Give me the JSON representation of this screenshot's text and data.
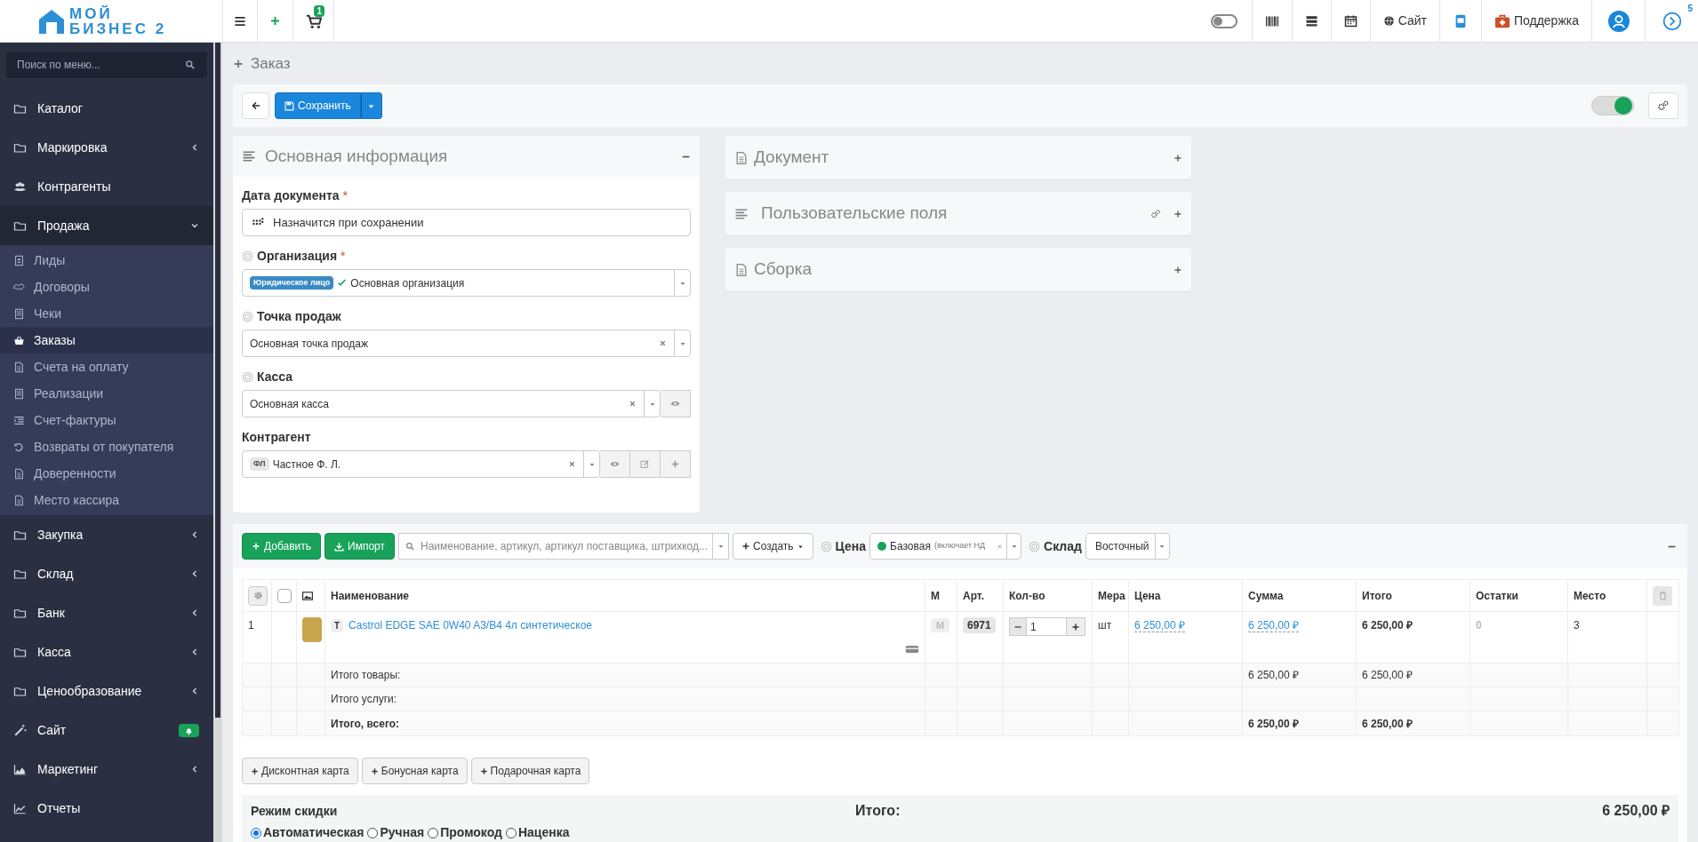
{
  "header": {
    "logo_top": "МОЙ",
    "logo_bottom": "БИЗНЕС 2",
    "cart_badge": "1",
    "mode_toggle_on": false,
    "site_link": "Сайт",
    "support_link": "Поддержка",
    "updates_badge": "5"
  },
  "sidebar": {
    "search_placeholder": "Поиск по меню...",
    "items": [
      {
        "kind": "link",
        "label": "Каталог"
      },
      {
        "kind": "group",
        "label": "Маркировка",
        "expanded": false
      },
      {
        "kind": "link",
        "label": "Контрагенты"
      },
      {
        "kind": "group",
        "label": "Продажа",
        "expanded": true,
        "children": [
          {
            "label": "Лиды",
            "selected": false
          },
          {
            "label": "Договоры",
            "selected": false
          },
          {
            "label": "Чеки",
            "selected": false
          },
          {
            "label": "Заказы",
            "selected": true
          },
          {
            "label": "Счета на оплату",
            "selected": false
          },
          {
            "label": "Реализации",
            "selected": false
          },
          {
            "label": "Счет-фактуры",
            "selected": false
          },
          {
            "label": "Возвраты от покупателя",
            "selected": false
          },
          {
            "label": "Доверенности",
            "selected": false
          },
          {
            "label": "Место кассира",
            "selected": false
          }
        ]
      },
      {
        "kind": "group",
        "label": "Закупка",
        "expanded": false
      },
      {
        "kind": "group",
        "label": "Склад",
        "expanded": false
      },
      {
        "kind": "group",
        "label": "Банк",
        "expanded": false
      },
      {
        "kind": "group",
        "label": "Касса",
        "expanded": false
      },
      {
        "kind": "group",
        "label": "Ценообразование",
        "expanded": false
      },
      {
        "kind": "link",
        "label": "Сайт",
        "bell_badge": true
      },
      {
        "kind": "group",
        "label": "Маркетинг",
        "expanded": false
      },
      {
        "kind": "link",
        "label": "Отчеты"
      }
    ]
  },
  "page_title": "Заказ",
  "toolbar": {
    "save_button": "Сохранить",
    "active_toggle_on": true
  },
  "main_info": {
    "title": "Основная информация",
    "fields": [
      {
        "kind": "date",
        "label": "Дата документа",
        "required_mark": "*",
        "value": "Назначится при сохранении"
      },
      {
        "kind": "select",
        "label": "Организация",
        "required_mark": "*",
        "hint_icon": true,
        "tag": "Юридическое лицо",
        "verified": true,
        "value": "Основная организация",
        "clearable": false
      },
      {
        "kind": "select",
        "label": "Точка продаж",
        "hint_icon": true,
        "value": "Основная точка продаж",
        "clearable": true
      },
      {
        "kind": "select-view",
        "label": "Касса",
        "hint_icon": true,
        "value": "Основная касса",
        "clearable": true
      },
      {
        "kind": "select-actions",
        "label": "Контрагент",
        "hint_icon": false,
        "tag": "ФЛ",
        "value": "Частное Ф. Л.",
        "clearable": true
      }
    ]
  },
  "side_panels": [
    {
      "kind": "document",
      "title": "Документ",
      "settings": false
    },
    {
      "kind": "list",
      "title": "Пользовательские поля",
      "settings": true
    },
    {
      "kind": "document",
      "title": "Сборка",
      "settings": false
    }
  ],
  "items_panel": {
    "add_button": "Добавить",
    "import_button": "Импорт",
    "search_placeholder": "Наименование, артикул, артикул поставщика, штрихкод...",
    "create_button": "Создать",
    "price_label": "Цена",
    "price_value": "Базовая",
    "price_note": "(включает НД",
    "warehouse_label": "Склад",
    "warehouse_value": "Восточный",
    "select_all_checked": false,
    "columns": [
      "Наименование",
      "М",
      "Арт.",
      "Кол-во",
      "Мера",
      "Цена",
      "Сумма",
      "Итого",
      "Остатки",
      "Место"
    ],
    "rows": [
      {
        "number": "1",
        "type_tag": "Т",
        "name": "Castrol EDGE SAE 0W40 A3/B4 4л синтетическое",
        "marking": "М",
        "article": "6971",
        "quantity": "1",
        "unit": "шт",
        "price": "6 250,00 ₽",
        "sum": "6 250,00 ₽",
        "total": "6 250,00 ₽",
        "stock": "0",
        "place": "3"
      }
    ],
    "totals": [
      {
        "kind": "plain",
        "label": "Итого товары:",
        "sum": "6 250,00 ₽",
        "total": "6 250,00 ₽"
      },
      {
        "kind": "plain",
        "label": "Итого услуги:"
      },
      {
        "kind": "grand",
        "label": "Итого, всего:",
        "sum": "6 250,00 ₽",
        "total": "6 250,00 ₽"
      }
    ],
    "card_buttons": [
      "Дисконтная карта",
      "Бонусная карта",
      "Подарочная карта"
    ],
    "discount_label": "Режим скидки",
    "grand_label": "Итого:",
    "grand_value": "6 250,00 ₽",
    "discount_modes": [
      {
        "label": "Автоматическая",
        "selected": true
      },
      {
        "label": "Ручная",
        "selected": false
      },
      {
        "label": "Промокод",
        "selected": false
      },
      {
        "label": "Наценка",
        "selected": false
      }
    ]
  }
}
